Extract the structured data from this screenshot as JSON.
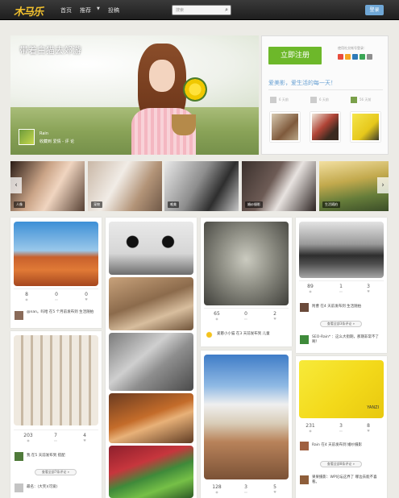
{
  "nav": {
    "logo": "木马乐",
    "links": [
      "首页",
      "推荐",
      "投稿"
    ],
    "search_placeholder": "搜索",
    "login": "登录"
  },
  "hero": {
    "title": "带着白猫去郊游",
    "user": "Rain",
    "meta": "收藏到 爱情 - 评 论"
  },
  "panel": {
    "register": "立即注册",
    "social_login_title": "使用社交帐号登录：",
    "social_colors": [
      "#e84c3d",
      "#f5a623",
      "#2e7ab8",
      "#3aa655",
      "#8e8e8e"
    ],
    "slogan": "爱美影，爱生活的每一天！",
    "user_labels": [
      "6 天前",
      "6 天前",
      "56 天前"
    ]
  },
  "carousel": {
    "tags": [
      "人像",
      "宠物",
      "唯美",
      "婚纱摄影",
      "生活随拍"
    ]
  },
  "col1": {
    "card1": {
      "stats": [
        "8",
        "0",
        "0"
      ],
      "comment": "@nan。吗哈 在5 个月前发布到 生活随拍"
    },
    "card2": {
      "stats": [
        "203",
        "7",
        "4"
      ],
      "comment": "我 在5 天前发布到 搭配",
      "more": "查看全部7条评论 »",
      "comment2": "最名：(大笑)(可爱)"
    }
  },
  "col3": {
    "card1": {
      "stats": [
        "65",
        "0",
        "2"
      ],
      "comment": "爱憨小小猫 在3 天前发布到 儿童"
    },
    "card2": {
      "stats": [
        "128",
        "3",
        "5"
      ]
    }
  },
  "col4": {
    "card1": {
      "stats": [
        "89",
        "1",
        "3"
      ],
      "comment1": "附曹 在4 天前发布到 生活随拍",
      "more": "查看全部3条评论 »",
      "comment2": "SEO-Rain* ：这么大街期，那期非常不了啊！"
    },
    "card2": {
      "stats": [
        "231",
        "3",
        "8"
      ],
      "comment1": "Rain 在4 天前发布到 婚纱摄影",
      "more": "查看全部8条评论 »",
      "comment2": "果果摄影：WP论坛这界了 哪边去能不喜看。"
    },
    "yellow_text": "YANZI"
  },
  "stat_icons": [
    "eye-icon",
    "comment-icon",
    "heart-icon"
  ]
}
